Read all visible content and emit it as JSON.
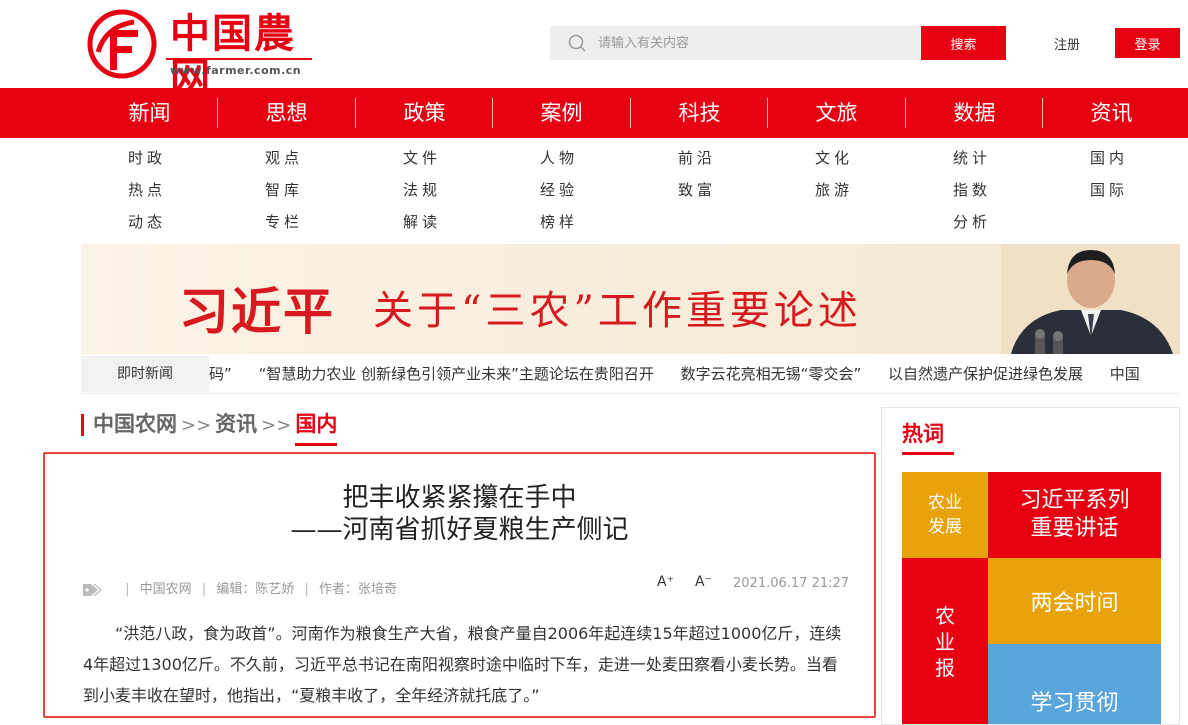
{
  "header": {
    "logo_text": "中国農网",
    "logo_url": "www.farmer.com.cn",
    "search_placeholder": "请输入有关内容",
    "search_label": "搜索",
    "register_label": "注册",
    "login_label": "登录"
  },
  "colors": {
    "brand_red": "#e60012",
    "tile_gold": "#e8a20c",
    "tile_blue": "#5aa6dc"
  },
  "main_nav": [
    "新闻",
    "思想",
    "政策",
    "案例",
    "科技",
    "文旅",
    "数据",
    "资讯"
  ],
  "sub_nav": [
    [
      "时政",
      "热点",
      "动态"
    ],
    [
      "观点",
      "智库",
      "专栏"
    ],
    [
      "文件",
      "法规",
      "解读"
    ],
    [
      "人物",
      "经验",
      "榜样"
    ],
    [
      "前沿",
      "致富"
    ],
    [
      "文化",
      "旅游"
    ],
    [
      "统计",
      "指数",
      "分析"
    ],
    [
      "国内",
      "国际"
    ]
  ],
  "banner": {
    "name": "习近平",
    "title": "关于“三农”工作重要论述"
  },
  "ticker": {
    "label": "即时新闻",
    "items": [
      "码”",
      "“智慧助力农业 创新绿色引领产业未来”主题论坛在贵阳召开",
      "数字云花亮相无锡“零交会”",
      "以自然遗产保护促进绿色发展",
      "中国"
    ]
  },
  "breadcrumb": {
    "home": "中国农网",
    "sep": ">>",
    "section": "资讯",
    "current": "国内"
  },
  "article": {
    "title_line1": "把丰收紧紧攥在手中",
    "title_line2": "——河南省抓好夏粮生产侧记",
    "tag_icon": "tag-icon",
    "source": "中国农网",
    "editor": "编辑：陈艺娇",
    "author": "作者：张培奇",
    "font_up": "A⁺",
    "font_down": "A⁻",
    "date": "2021.06.17 21:27",
    "body": "“洪范八政，食为政首”。河南作为粮食生产大省，粮食产量自2006年起连续15年超过1000亿斤，连续4年超过1300亿斤。不久前，习近平总书记在南阳视察时途中临时下车，走进一处麦田察看小麦长势。当看到小麦丰收在望时，他指出，“夏粮丰收了，全年经济就托底了。”"
  },
  "sidebar": {
    "title": "热词",
    "tiles": {
      "t1": "农业\n发展",
      "t2": "习近平系列\n重要讲话",
      "t3": "农\n业\n报",
      "t4": "两会时间",
      "t5": "学习贯彻"
    }
  }
}
